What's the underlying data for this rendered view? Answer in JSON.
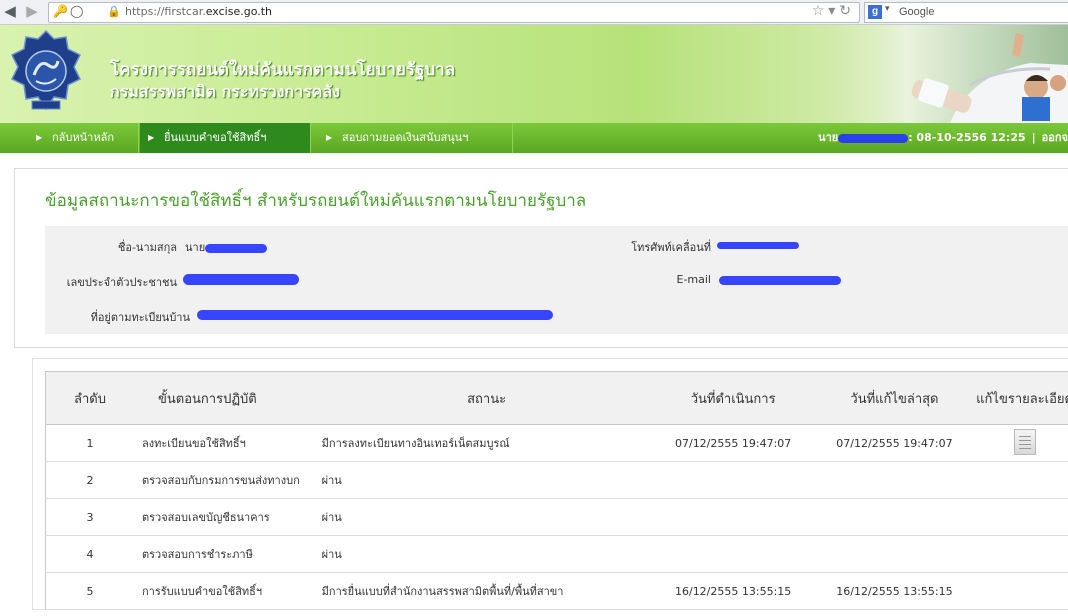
{
  "browser": {
    "url_prefix": "https://firstcar.",
    "url_domain": "excise.go.th",
    "search_placeholder": "Google",
    "search_engine_letter": "g"
  },
  "header": {
    "title_line1": "โครงการรถยนต์ใหม่คันแรกตามนโยบายรัฐบาล",
    "title_line2": "กรมสรรพสามิต กระทรวงการคลัง"
  },
  "menu": {
    "items": [
      {
        "label": "กลับหน้าหลัก"
      },
      {
        "label": "ยื่นแบบคำขอใช้สิทธิ์ฯ"
      },
      {
        "label": "สอบถามยอดเงินสนับสนุนฯ"
      }
    ],
    "user_prefix": "นาย",
    "login_datetime": ": 08-10-2556 12:25",
    "separator": "|",
    "logout": "ออกจ"
  },
  "info": {
    "title": "ข้อมูลสถานะการขอใช้สิทธิ์ฯ สำหรับรถยนต์ใหม่คันแรกตามนโยบายรัฐบาล",
    "name_label": "ชื่อ-นามสกุล",
    "name_prefix": "นาย",
    "id_label": "เลขประจำตัวประชาชน",
    "address_label": "ที่อยู่ตามทะเบียนบ้าน",
    "mobile_label": "โทรศัพท์เคลื่อนที่",
    "email_label": "E-mail"
  },
  "steps": {
    "headers": [
      "ลำดับ",
      "ขั้นตอนการปฏิบัติ",
      "สถานะ",
      "วันที่ดำเนินการ",
      "วันที่แก้ไขล่าสุด",
      "แก้ไขรายละเอียด"
    ],
    "rows": [
      {
        "no": "1",
        "step": "ลงทะเบียนขอใช้สิทธิ์ฯ",
        "status": "มีการลงทะเบียนทางอินเทอร์เน็ตสมบูรณ์",
        "date": "07/12/2555 19:47:07",
        "updated": "07/12/2555 19:47:07",
        "edit_icon": "document-icon"
      },
      {
        "no": "2",
        "step": "ตรวจสอบกับกรมการขนส่งทางบก",
        "status": "ผ่าน",
        "date": "",
        "updated": ""
      },
      {
        "no": "3",
        "step": "ตรวจสอบเลขบัญชีธนาคาร",
        "status": "ผ่าน",
        "date": "",
        "updated": ""
      },
      {
        "no": "4",
        "step": "ตรวจสอบการชำระภาษี",
        "status": "ผ่าน",
        "date": "",
        "updated": ""
      },
      {
        "no": "5",
        "step": "การรับแบบคำขอใช้สิทธิ์ฯ",
        "status": "มีการยื่นแบบที่สำนักงานสรรพสามิตพื้นที่/พื้นที่สาขา",
        "date": "16/12/2555 13:55:15",
        "updated": "16/12/2555 13:55:15"
      }
    ]
  },
  "colors": {
    "menu_green": "#5aa822",
    "menu_active": "#2f8a1e",
    "title_green": "#4aa02c",
    "redaction_blue": "#2233ff"
  }
}
